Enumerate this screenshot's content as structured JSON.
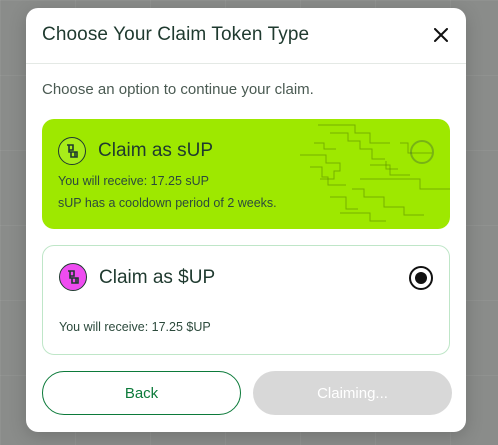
{
  "modal": {
    "title": "Choose Your Claim Token Type",
    "close_icon": "close-icon",
    "subtitle": "Choose an option to continue your claim."
  },
  "options": [
    {
      "title": "Claim as sUP",
      "icon": "token-logo-icon",
      "lines": [
        "You will receive: 17.25 sUP",
        "sUP has a cooldown period of 2 weeks."
      ],
      "selected": false,
      "background": "#9ee800"
    },
    {
      "title": "Claim as $UP",
      "icon": "token-logo-icon",
      "lines": [
        "You will receive: 17.25 $UP"
      ],
      "selected": true,
      "background": "#ffffff"
    }
  ],
  "buttons": {
    "back_label": "Back",
    "claiming_label": "Claiming..."
  },
  "colors": {
    "accent_green": "#0c7a3a",
    "lime": "#9ee800",
    "pink": "#ee4cf0",
    "disabled": "#d8d8d8"
  }
}
